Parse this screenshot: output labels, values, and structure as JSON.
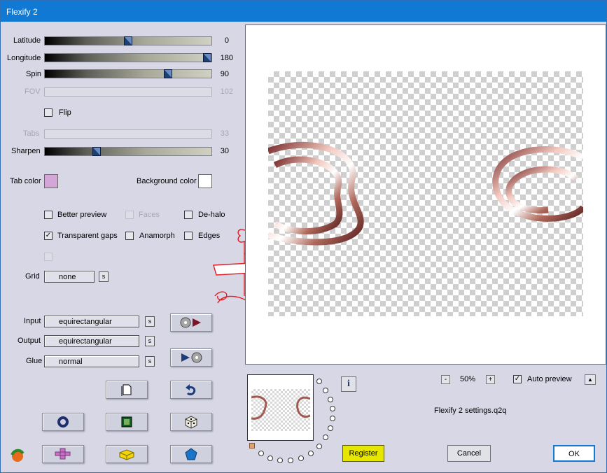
{
  "window": {
    "title": "Flexify 2"
  },
  "sliders": [
    {
      "label": "Latitude",
      "value": "0",
      "level": 0.5,
      "enabled": true
    },
    {
      "label": "Longitude",
      "value": "180",
      "level": 1.0,
      "enabled": true
    },
    {
      "label": "Spin",
      "value": "90",
      "level": 0.74,
      "enabled": true
    },
    {
      "label": "FOV",
      "value": "102",
      "level": null,
      "enabled": false
    },
    {
      "label": "Tabs",
      "value": "33",
      "level": null,
      "enabled": false
    },
    {
      "label": "Sharpen",
      "value": "30",
      "level": 0.3,
      "enabled": true
    }
  ],
  "flip": {
    "label": "Flip",
    "checked": false
  },
  "colors": {
    "tab_label": "Tab color",
    "tab_color": "#d4a6d8",
    "bg_label": "Background color",
    "bg_color": "#ffffff"
  },
  "options": {
    "better_preview": {
      "label": "Better preview",
      "checked": false
    },
    "faces": {
      "label": "Faces",
      "checked": false,
      "enabled": false
    },
    "de_halo": {
      "label": "De-halo",
      "checked": false
    },
    "transparent_gaps": {
      "label": "Transparent gaps",
      "checked": true
    },
    "anamorph": {
      "label": "Anamorph",
      "checked": false
    },
    "edges": {
      "label": "Edges",
      "checked": false
    }
  },
  "grid": {
    "label": "Grid",
    "value": "none",
    "s": "s"
  },
  "input": {
    "label": "Input",
    "value": "equirectangular",
    "s": "s"
  },
  "output": {
    "label": "Output",
    "value": "equirectangular",
    "s": "s"
  },
  "glue": {
    "label": "Glue",
    "value": "normal",
    "s": "s"
  },
  "watermark_text": "Christopher Ina",
  "zoom": {
    "minus": "-",
    "value": "50%",
    "plus": "+"
  },
  "auto_preview": {
    "label": "Auto preview",
    "checked": true,
    "up": "▲"
  },
  "settings_file": "Flexify 2 settings.q2q",
  "buttons": {
    "register": "Register",
    "cancel": "Cancel",
    "ok": "OK"
  },
  "info_icon": "i",
  "accent": "#0f79d4"
}
